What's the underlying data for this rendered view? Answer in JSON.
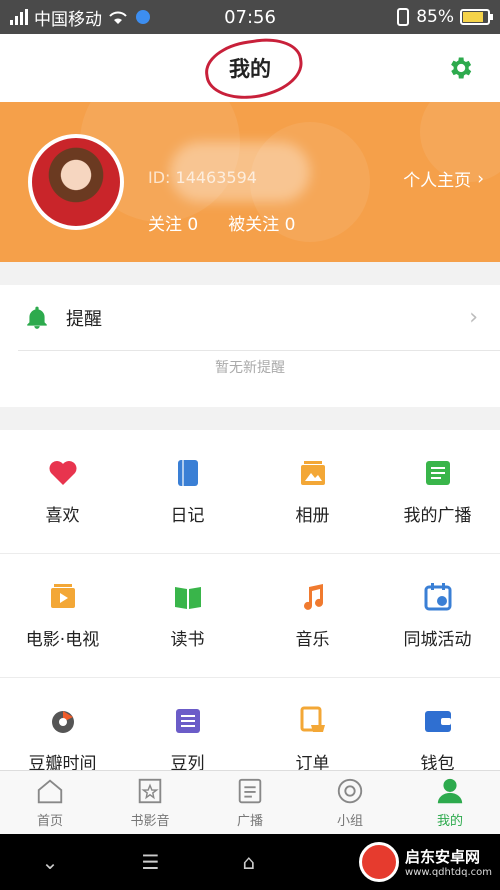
{
  "status": {
    "carrier": "中国移动",
    "time": "07:56",
    "battery": "85%",
    "battery_level": 0.85
  },
  "header": {
    "title": "我的"
  },
  "profile": {
    "id_text": "ID: 14463594",
    "homepage_label": "个人主页",
    "following": "关注 0",
    "followers": "被关注 0"
  },
  "reminder": {
    "label": "提醒",
    "empty_text": "暂无新提醒"
  },
  "grid": {
    "rows": [
      [
        {
          "label": "喜欢",
          "icon": "heart-icon",
          "color": "#e8344e"
        },
        {
          "label": "日记",
          "icon": "diary-icon",
          "color": "#3a7fd5"
        },
        {
          "label": "相册",
          "icon": "album-icon",
          "color": "#f3a736"
        },
        {
          "label": "我的广播",
          "icon": "broadcast-icon",
          "color": "#39b54a"
        }
      ],
      [
        {
          "label": "电影·电视",
          "icon": "movie-tv-icon",
          "color": "#f3a736"
        },
        {
          "label": "读书",
          "icon": "book-icon",
          "color": "#39b54a"
        },
        {
          "label": "音乐",
          "icon": "music-icon",
          "color": "#f07a2f"
        },
        {
          "label": "同城活动",
          "icon": "event-icon",
          "color": "#3a7fd5"
        }
      ],
      [
        {
          "label": "豆瓣时间",
          "icon": "douban-time-icon",
          "color": "#f05c2a"
        },
        {
          "label": "豆列",
          "icon": "list-icon",
          "color": "#6b5cc8"
        },
        {
          "label": "订单",
          "icon": "order-icon",
          "color": "#f3a736"
        },
        {
          "label": "钱包",
          "icon": "wallet-icon",
          "color": "#2f6fd1"
        }
      ]
    ]
  },
  "tabs": [
    {
      "label": "首页",
      "icon": "home-icon"
    },
    {
      "label": "书影音",
      "icon": "media-icon"
    },
    {
      "label": "广播",
      "icon": "broadcast-tab-icon"
    },
    {
      "label": "小组",
      "icon": "group-icon"
    },
    {
      "label": "我的",
      "icon": "profile-icon",
      "active": true
    }
  ],
  "watermark": {
    "title": "启东安卓网",
    "url": "www.qdhtdq.com"
  },
  "colors": {
    "accent": "#2daa4d",
    "profile_bg": "#f5a04a"
  }
}
